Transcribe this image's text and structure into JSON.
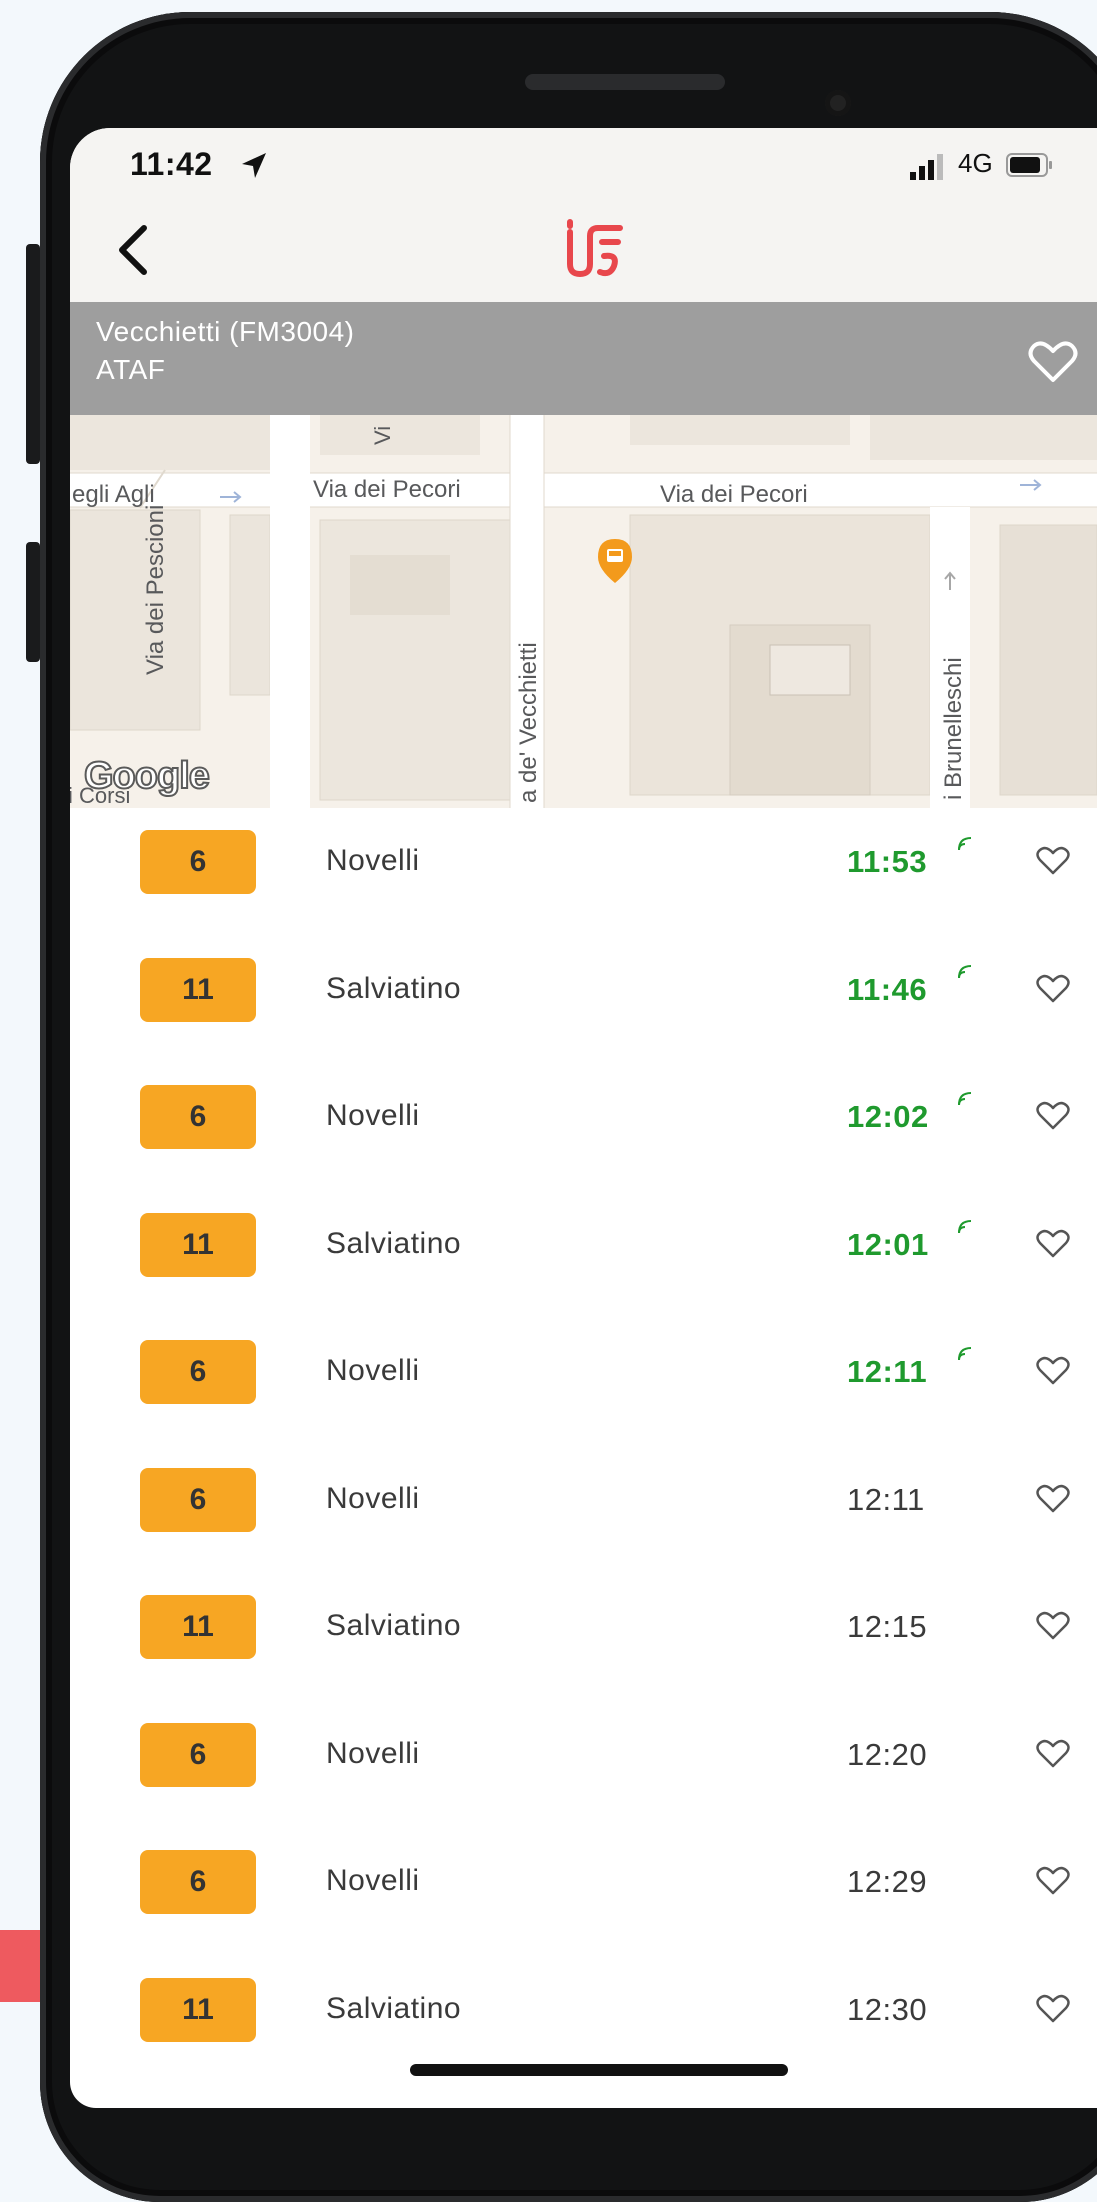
{
  "status_bar": {
    "time": "11:42",
    "network": "4G"
  },
  "stop": {
    "name": "Vecchietti (FM3004)",
    "agency": "ATAF"
  },
  "map": {
    "streets": [
      {
        "label": "egli Agli"
      },
      {
        "label": "Via dei Pecori"
      },
      {
        "label": "Via dei Pecori"
      },
      {
        "label": "Via dei Pescioni"
      },
      {
        "label": "a de' Vecchietti"
      },
      {
        "label": "i Brunelleschi"
      },
      {
        "label": "i Corsi"
      },
      {
        "label": "Vi"
      }
    ],
    "google": "Google"
  },
  "departures": [
    {
      "line": "6",
      "destination": "Novelli",
      "time": "11:53",
      "realtime": true
    },
    {
      "line": "11",
      "destination": "Salviatino",
      "time": "11:46",
      "realtime": true
    },
    {
      "line": "6",
      "destination": "Novelli",
      "time": "12:02",
      "realtime": true
    },
    {
      "line": "11",
      "destination": "Salviatino",
      "time": "12:01",
      "realtime": true
    },
    {
      "line": "6",
      "destination": "Novelli",
      "time": "12:11",
      "realtime": true
    },
    {
      "line": "6",
      "destination": "Novelli",
      "time": "12:11",
      "realtime": false
    },
    {
      "line": "11",
      "destination": "Salviatino",
      "time": "12:15",
      "realtime": false
    },
    {
      "line": "6",
      "destination": "Novelli",
      "time": "12:20",
      "realtime": false
    },
    {
      "line": "6",
      "destination": "Novelli",
      "time": "12:29",
      "realtime": false
    },
    {
      "line": "11",
      "destination": "Salviatino",
      "time": "12:30",
      "realtime": false
    }
  ],
  "colors": {
    "line_badge": "#f7a623",
    "realtime_text": "#1f9a2e",
    "header_gray": "#9e9e9e",
    "brand_red": "#e8474c",
    "accent": "#ee5a5f"
  },
  "icons": {
    "back": "chevron-left-icon",
    "favorite": "heart-outline-icon",
    "realtime": "realtime-signal-icon",
    "bus_stop": "bus-stop-marker-icon",
    "location": "location-arrow-icon"
  }
}
